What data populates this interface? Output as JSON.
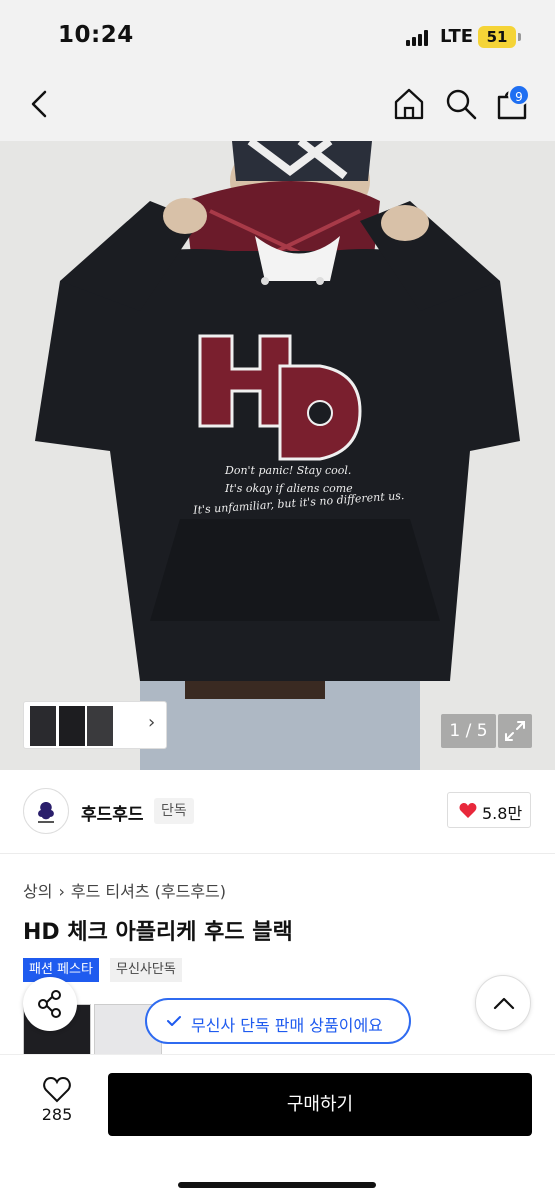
{
  "status_bar": {
    "time": "10:24",
    "network": "LTE",
    "battery": "51"
  },
  "nav": {
    "back_icon": "chevron-left-icon",
    "home_icon": "home-icon",
    "search_icon": "search-icon",
    "bag_icon": "shopping-bag-icon",
    "bag_count": "9"
  },
  "hero": {
    "print_lines": [
      "Don't panic! Stay cool.",
      "It's okay if aliens come",
      "It's unfamiliar, but it's no different us."
    ],
    "counter": "1 / 5",
    "expand_icon": "expand-icon",
    "thumb_strip_icon": "chevron-right-icon"
  },
  "brand": {
    "name": "후드후드",
    "tag": "단독",
    "likes": "5.8만"
  },
  "breadcrumb": [
    "상의",
    "후드 티셔츠 (후드후드)"
  ],
  "product": {
    "title": "HD 체크 아플리케 후드 블랙",
    "tags": [
      "패션 페스타",
      "무신사단독"
    ]
  },
  "floating": {
    "exclusive_text": "무신사 단독 판매 상품이에요",
    "share_icon": "share-icon",
    "scroll_top_icon": "chevron-up-icon"
  },
  "bottom": {
    "wish_count": "285",
    "buy_label": "구매하기"
  },
  "colors": {
    "accent_blue": "#1f5bef",
    "heart_red": "#e8283b",
    "battery_yellow": "#f5d437"
  }
}
